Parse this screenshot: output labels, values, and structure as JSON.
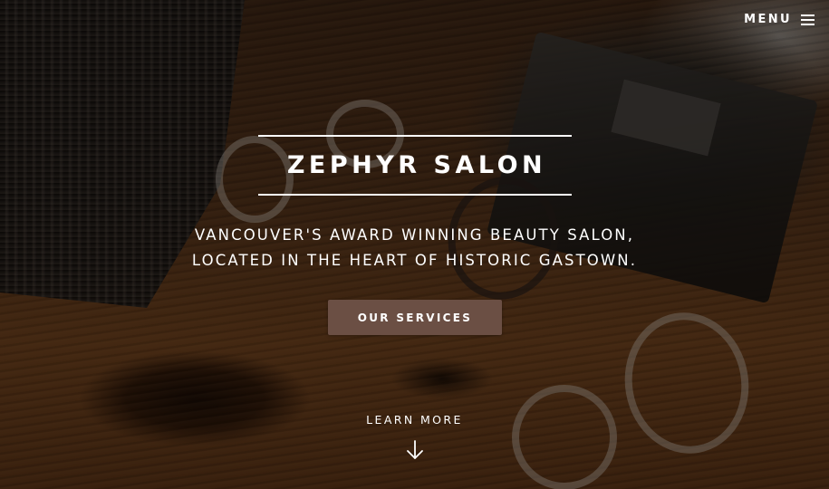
{
  "header": {
    "menu_label": "MENU",
    "menu_icon": "hamburger-icon"
  },
  "hero": {
    "title": "ZEPHYR SALON",
    "tagline_line1": "VANCOUVER'S AWARD WINNING BEAUTY SALON,",
    "tagline_line2": "LOCATED IN THE HEART OF HISTORIC GASTOWN.",
    "cta_label": "OUR SERVICES",
    "learn_more_label": "LEARN MORE",
    "learn_more_icon": "arrow-down-icon"
  },
  "colors": {
    "button_bg": "#6b4f44",
    "text": "#ffffff"
  }
}
